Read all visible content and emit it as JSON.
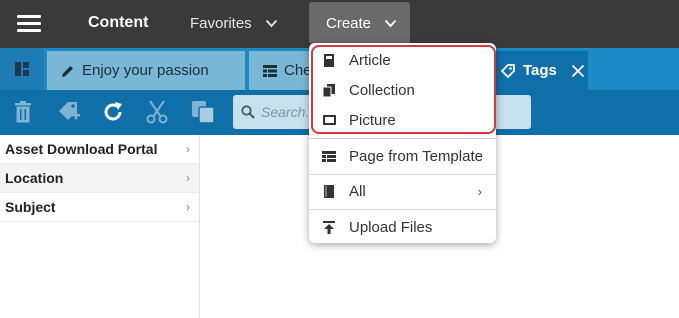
{
  "topbar": {
    "app_title": "Content",
    "favorites_label": "Favorites",
    "create_label": "Create"
  },
  "tabs": [
    {
      "label": "Enjoy your passion",
      "icon": "pencil-icon"
    },
    {
      "label": "Che",
      "icon": "grid-icon"
    },
    {
      "label": "Tags",
      "icon": "tag-icon",
      "active": true
    }
  ],
  "toolbar": {
    "search_placeholder": "Search..."
  },
  "tree": {
    "items": [
      {
        "label": "Asset Download Portal"
      },
      {
        "label": "Location",
        "selected": true
      },
      {
        "label": "Subject"
      }
    ]
  },
  "create_menu": {
    "items": [
      {
        "label": "Article",
        "icon": "article-icon"
      },
      {
        "label": "Collection",
        "icon": "collection-icon"
      },
      {
        "label": "Picture",
        "icon": "picture-icon"
      },
      {
        "label": "Page from Template",
        "icon": "template-icon"
      },
      {
        "label": "All",
        "icon": "all-icon",
        "submenu": true
      },
      {
        "label": "Upload Files",
        "icon": "upload-icon"
      }
    ]
  },
  "colors": {
    "topbar": "#3a3a3a",
    "tabbar": "#1b8ac5",
    "toolbar": "#0f6fa8",
    "highlight": "#d6383d"
  }
}
